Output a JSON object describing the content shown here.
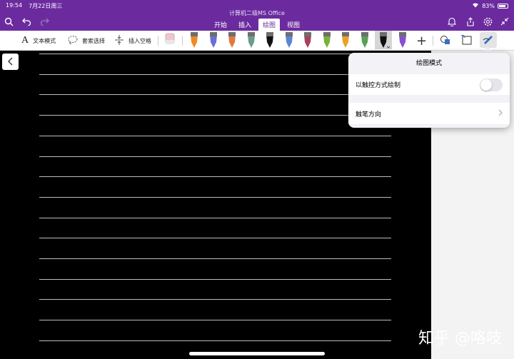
{
  "status": {
    "time": "19:54",
    "date": "7月22日周三",
    "battery": "83%",
    "battery_level": 0.83
  },
  "document": {
    "title": "计算机二级MS Office"
  },
  "tabs": [
    {
      "label": "开始"
    },
    {
      "label": "插入"
    },
    {
      "label": "绘图"
    },
    {
      "label": "视图"
    }
  ],
  "active_tab": "绘图",
  "toolbar": {
    "text_mode": "文本模式",
    "lasso_select": "套索选择",
    "insert_space": "插入空格",
    "pens": [
      {
        "color": "#f08a24",
        "kind": "highlighter"
      },
      {
        "color": "#6a6fd4",
        "kind": "pen"
      },
      {
        "color": "#e07a3c",
        "kind": "pen"
      },
      {
        "color": "#6b9c8c",
        "kind": "pen"
      },
      {
        "color": "#111111",
        "kind": "pen"
      },
      {
        "color": "#5b86d6",
        "kind": "pen"
      },
      {
        "color": "#a8405e",
        "kind": "pen"
      },
      {
        "color": "#7bb03c",
        "kind": "pen"
      },
      {
        "color": "#e8a228",
        "kind": "pen"
      },
      {
        "color": "#58a058",
        "kind": "pen"
      },
      {
        "color": "#111111",
        "kind": "pen-selected"
      },
      {
        "color": "#8a4fd0",
        "kind": "pen"
      }
    ]
  },
  "popover": {
    "title": "绘图模式",
    "touch_draw_label": "以触控方式绘制",
    "touch_draw_on": false,
    "pen_direction_label": "触笔方向"
  },
  "watermark": "知乎 @咯吱",
  "colors": {
    "brand": "#6b2b9f",
    "canvas": "#000000"
  }
}
